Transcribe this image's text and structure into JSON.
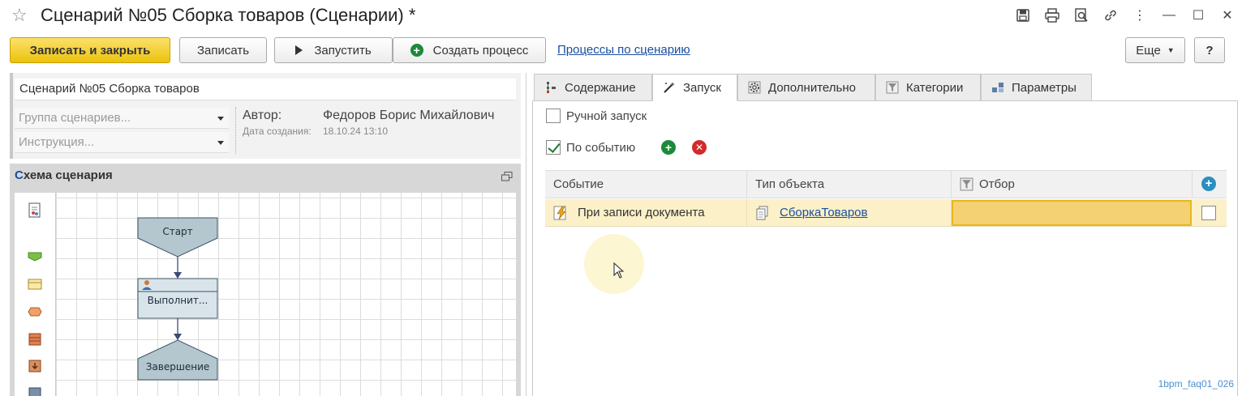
{
  "window": {
    "title": "Сценарий №05 Сборка товаров (Сценарии) *"
  },
  "toolbar": {
    "save_close": "Записать и закрыть",
    "save": "Записать",
    "run": "Запустить",
    "create_process": "Создать процесс",
    "processes_link": "Процессы по сценарию",
    "more": "Еще",
    "help": "?"
  },
  "form": {
    "name": "Сценарий №05 Сборка товаров",
    "group_placeholder": "Группа сценариев...",
    "instruction_placeholder": "Инструкция...",
    "author_label": "Автор:",
    "author_value": "Федоров Борис Михайлович",
    "created_label": "Дата создания:",
    "created_value": "18.10.24 13:10"
  },
  "schema": {
    "title_first": "С",
    "title_rest": "хема сценария",
    "nodes": {
      "start": "Старт",
      "task": "Выполнит...",
      "end": "Завершение"
    }
  },
  "tabs": [
    {
      "label": "Содержание",
      "icon": "content-icon"
    },
    {
      "label": "Запуск",
      "icon": "magic-wand-icon",
      "active": true
    },
    {
      "label": "Дополнительно",
      "icon": "gear-icon"
    },
    {
      "label": "Категории",
      "icon": "funnel-icon"
    },
    {
      "label": "Параметры",
      "icon": "parameters-icon"
    }
  ],
  "launch": {
    "manual_label": "Ручной запуск",
    "manual_checked": false,
    "event_label": "По событию",
    "event_checked": true
  },
  "events_table": {
    "columns": [
      "Событие",
      "Тип объекта",
      "Отбор"
    ],
    "rows": [
      {
        "event": "При записи документа",
        "object_type": "СборкаТоваров",
        "filter": "",
        "flag": false
      }
    ]
  },
  "watermark": "1bpm_faq01_026",
  "colors": {
    "primary_button": "#ecc20d",
    "link": "#1a4fa0",
    "selected_row": "#fbf0c8",
    "add_green": "#1c8a3a",
    "delete_red": "#d22b2b",
    "node_fill": "#b4c6ce"
  }
}
